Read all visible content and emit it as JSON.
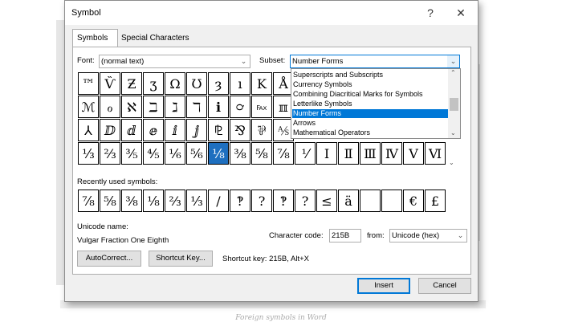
{
  "dialog": {
    "title": "Symbol",
    "help_label": "?",
    "close_label": "✕",
    "tabs": [
      {
        "label": "Symbols",
        "active": true
      },
      {
        "label": "Special Characters",
        "active": false
      }
    ],
    "font_label": "Font:",
    "font_value": "(normal text)",
    "subset_label": "Subset:",
    "subset_value": "Number Forms",
    "subset_options": [
      "Superscripts and Subscripts",
      "Currency Symbols",
      "Combining Diacritical Marks for Symbols",
      "Letterlike Symbols",
      "Number Forms",
      "Arrows",
      "Mathematical Operators"
    ],
    "subset_selected_index": 4,
    "symbol_rows": [
      [
        "™",
        "Ѷ",
        "Ƶ",
        "ʒ",
        "Ω",
        "Ʊ",
        "ȝ",
        "ı",
        "K",
        "Å"
      ],
      [
        "ℳ",
        "ℴ",
        "ℵ",
        "ℶ",
        "ℷ",
        "ℸ",
        "ℹ",
        "℺",
        "℻",
        "ℼ"
      ],
      [
        "⅄",
        "ⅅ",
        "ⅆ",
        "ⅇ",
        "ⅈ",
        "ⅉ",
        "⅊",
        "⅋",
        "⅌",
        "⅍"
      ],
      [
        "⅓",
        "⅔",
        "⅗",
        "⅘",
        "⅙",
        "⅚",
        "⅛",
        "⅜",
        "⅝",
        "⅞",
        "⅟",
        "Ⅰ",
        "Ⅱ",
        "Ⅲ",
        "Ⅳ",
        "Ⅴ",
        "Ⅵ"
      ]
    ],
    "selected_symbol": "⅛",
    "recent_label": "Recently used symbols:",
    "recent_symbols": [
      "⅞",
      "⅝",
      "⅜",
      "⅛",
      "⅔",
      "⅓",
      "/",
      "‽",
      "?",
      "‽",
      "?",
      "≤",
      "ä",
      "",
      "",
      "€",
      "£"
    ],
    "unicode_name_label": "Unicode name:",
    "unicode_name_value": "Vulgar Fraction One Eighth",
    "character_code_label": "Character code:",
    "character_code_value": "215B",
    "from_label": "from:",
    "from_value": "Unicode (hex)",
    "autocorrect_label": "AutoCorrect...",
    "shortcut_key_button_label": "Shortcut Key...",
    "shortcut_key_text": "Shortcut key: 215B, Alt+X",
    "insert_label": "Insert",
    "cancel_label": "Cancel"
  },
  "caption": "Foreign symbols in Word"
}
